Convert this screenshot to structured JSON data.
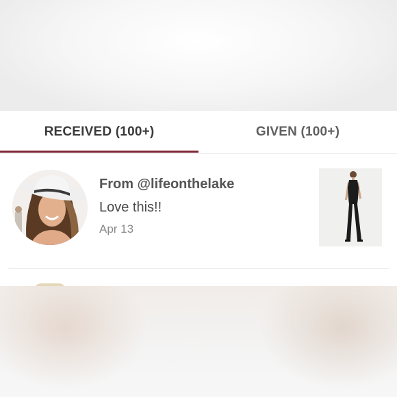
{
  "tabs": {
    "received_label": "RECEIVED (100+)",
    "given_label": "GIVEN (100+)",
    "active": "received",
    "accent_color": "#7d2635"
  },
  "entry": {
    "from_text": "From @lifeonthelake",
    "message": "Love this!!",
    "date": "Apr 13"
  }
}
